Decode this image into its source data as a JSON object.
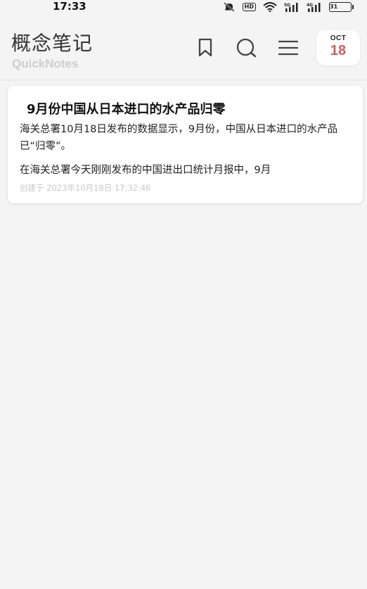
{
  "status_bar": {
    "time": "17:33",
    "hd_label": "HD",
    "battery": "31",
    "icons": [
      "mute-icon",
      "hd-icon",
      "wifi-icon",
      "signal-5g-icon",
      "signal-4g-icon",
      "battery-icon"
    ]
  },
  "header": {
    "title": "概念笔记",
    "subtitle": "QuickNotes",
    "icons": [
      "bookmark-icon",
      "search-icon",
      "menu-icon"
    ],
    "date_badge": {
      "month": "OCT",
      "day": "18"
    }
  },
  "notes": [
    {
      "title": "9月份中国从日本进口的水产品归零",
      "line1": "海关总署10月18日发布的数据显示，9月份，中国从日本进口的水产品已“归零”。",
      "line2": "在海关总署今天刚刚发布的中国进出口统计月报中，9月",
      "created": "创建于 2023年10月18日 17:32:46"
    }
  ],
  "colors": {
    "background": "#f4f4f4",
    "card": "#ffffff",
    "date_accent": "#d45a5a",
    "subtitle": "#cdcdcd",
    "meta_text": "#c8c8c8"
  }
}
